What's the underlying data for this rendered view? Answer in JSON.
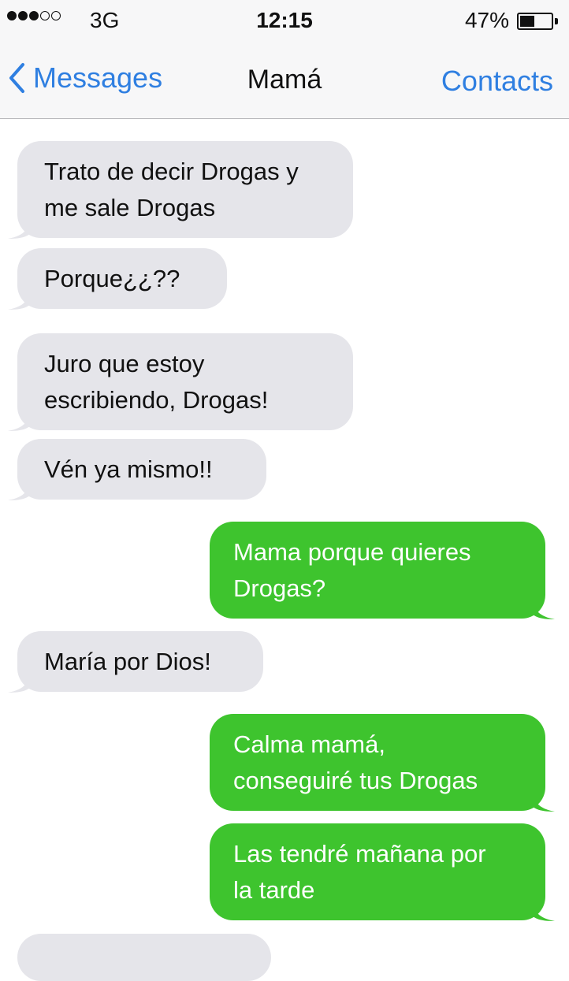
{
  "status_bar": {
    "signal_bars": [
      true,
      true,
      true,
      false,
      false
    ],
    "carrier": "3G",
    "time": "12:15",
    "battery_percent": "47%",
    "battery_level": 0.47
  },
  "nav": {
    "back_label": "Messages",
    "title": "Mamá",
    "contacts_label": "Contacts"
  },
  "messages": [
    {
      "direction": "incoming",
      "lines": [
        "Trato de decir Drogas y",
        "me sale Drogas"
      ]
    },
    {
      "direction": "incoming",
      "lines": [
        "Porque¿¿??"
      ]
    },
    {
      "direction": "incoming",
      "lines": [
        "Juro que estoy",
        "escribiendo, Drogas!"
      ]
    },
    {
      "direction": "incoming",
      "lines": [
        "Vén ya mismo!!"
      ]
    },
    {
      "direction": "outgoing",
      "lines": [
        "Mama porque quieres",
        "Drogas?"
      ]
    },
    {
      "direction": "incoming",
      "lines": [
        "María por Dios!"
      ]
    },
    {
      "direction": "outgoing",
      "lines": [
        "Calma mamá,",
        "conseguiré tus Drogas"
      ]
    },
    {
      "direction": "outgoing",
      "lines": [
        "Las tendré mañana por",
        "la tarde"
      ]
    },
    {
      "direction": "incoming",
      "lines": [
        ""
      ]
    }
  ],
  "colors": {
    "incoming_bubble": "#e5e5ea",
    "outgoing_bubble": "#3ec42e",
    "link_blue": "#2f7fe1"
  }
}
